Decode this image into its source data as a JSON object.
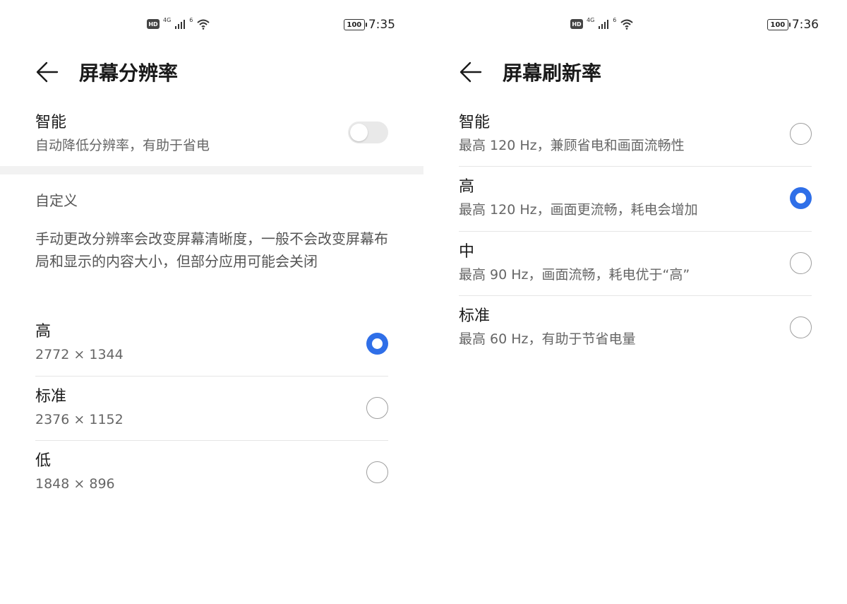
{
  "left": {
    "status": {
      "hd": "HD",
      "network": "4G",
      "sim2": "6",
      "battery": "100",
      "time": "7:35"
    },
    "title": "屏幕分辨率",
    "smart": {
      "title": "智能",
      "subtitle": "自动降低分辨率，有助于省电",
      "toggle_on": false
    },
    "section_label": "自定义",
    "description": "手动更改分辨率会改变屏幕清晰度，一般不会改变屏幕布局和显示的内容大小，但部分应用可能会关闭",
    "options": [
      {
        "title": "高",
        "subtitle": "2772 × 1344",
        "selected": true
      },
      {
        "title": "标准",
        "subtitle": "2376 × 1152",
        "selected": false
      },
      {
        "title": "低",
        "subtitle": "1848 × 896",
        "selected": false
      }
    ]
  },
  "right": {
    "status": {
      "hd": "HD",
      "network": "4G",
      "sim2": "6",
      "battery": "100",
      "time": "7:36"
    },
    "title": "屏幕刷新率",
    "options": [
      {
        "title": "智能",
        "subtitle": "最高 120 Hz，兼顾省电和画面流畅性",
        "selected": false
      },
      {
        "title": "高",
        "subtitle": "最高 120 Hz，画面更流畅，耗电会增加",
        "selected": true
      },
      {
        "title": "中",
        "subtitle": "最高 90 Hz，画面流畅，耗电优于“高”",
        "selected": false
      },
      {
        "title": "标准",
        "subtitle": "最高 60 Hz，有助于节省电量",
        "selected": false
      }
    ]
  },
  "colors": {
    "accent": "#2f6fe8",
    "toggle_off": "#e9e9e9",
    "section_bg": "#f2f2f2"
  },
  "icons": {
    "back": "arrow-left-icon",
    "signal": "signal-icon",
    "wifi": "wifi-icon",
    "battery": "battery-icon"
  }
}
